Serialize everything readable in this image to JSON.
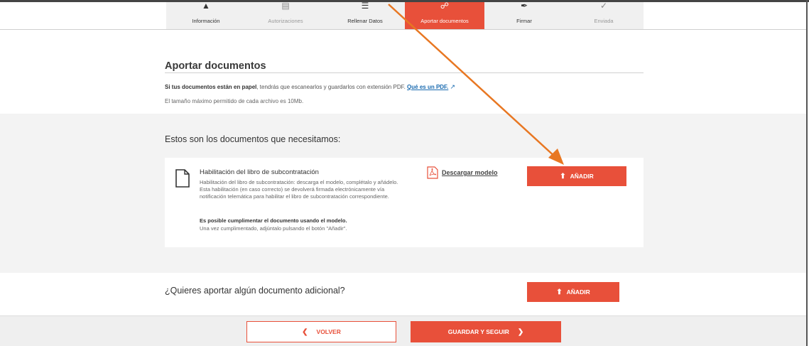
{
  "stepper": {
    "steps": [
      {
        "label": "Información",
        "icon": "person-icon",
        "state": "done"
      },
      {
        "label": "Autorizaciones",
        "icon": "document-icon",
        "state": "pending"
      },
      {
        "label": "Rellenar Datos",
        "icon": "lines-icon",
        "state": "done"
      },
      {
        "label": "Aportar documentos",
        "icon": "clip-icon",
        "state": "active"
      },
      {
        "label": "Firmar",
        "icon": "pen-icon",
        "state": "done"
      },
      {
        "label": "Enviada",
        "icon": "check-icon",
        "state": "pending"
      }
    ]
  },
  "page": {
    "title": "Aportar documentos",
    "info_bold": "Si tus documentos están en papel",
    "info_rest": ", tendrás que escanearlos y guardarlos con extensión PDF.",
    "pdf_link": "Qué es un PDF.",
    "max_size": "El tamaño máximo permitido de cada archivo es 10Mb."
  },
  "needed": {
    "title": "Estos son los documentos que necesitamos:",
    "document": {
      "name": "Habilitación del libro de subcontratación",
      "description": "Habilitación del libro de subcontratación: descarga el modelo, complétalo y añádelo. Esta habilitación (en caso correcto) se devolverá firmada electrónicamente vía notificación telemática para habilitar el libro de subcontratación correspondiente.",
      "note": "Es posible cumplimentar el documento usando el modelo.",
      "note2": "Una vez cumplimentado, adjúntalo pulsando el botón \"Añadir\".",
      "download_label": "Descargar modelo",
      "add_label": "AÑADIR"
    }
  },
  "additional": {
    "title": "¿Quieres aportar algún documento adicional?",
    "add_label": "AÑADIR"
  },
  "footer": {
    "back_label": "VOLVER",
    "save_label": "GUARDAR Y SEGUIR"
  },
  "colors": {
    "accent": "#e8503a",
    "annotation_arrow": "#e87722"
  }
}
